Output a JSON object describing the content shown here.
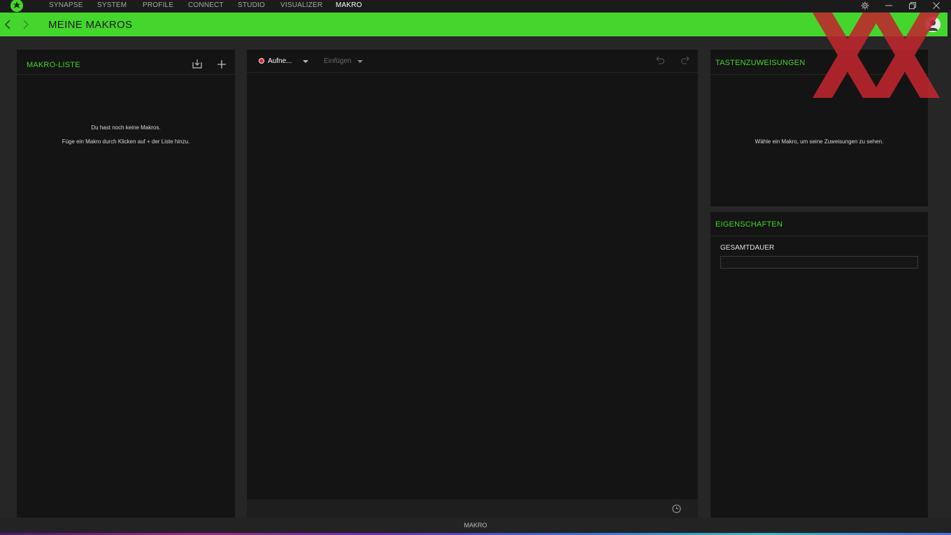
{
  "nav": {
    "items": [
      "SYNAPSE",
      "SYSTEM",
      "PROFILE",
      "CONNECT",
      "STUDIO",
      "VISUALIZER",
      "MAKRO"
    ],
    "active": "MAKRO"
  },
  "header": {
    "title": "MEINE MAKROS"
  },
  "macro_list": {
    "title": "MAKRO-LISTE",
    "empty_line1": "Du hast noch keine Makros.",
    "empty_line2": "Füge ein Makro durch Klicken auf + der Liste hinzu."
  },
  "editor": {
    "record_label": "Aufne...",
    "insert_label": "Einfügen"
  },
  "assignments": {
    "title": "TASTENZUWEISUNGEN",
    "empty_text": "Wähle ein Makro, um seine Zuweisungen zu sehen."
  },
  "properties": {
    "title": "EIGENSCHAFTEN",
    "total_duration_label": "GESAMTDAUER",
    "total_duration_value": ""
  },
  "statusbar": {
    "label": "MAKRO"
  },
  "colors": {
    "accent": "#44d62c",
    "panel_bg": "#141414",
    "app_bg": "#262626",
    "record_dot": "#e0242c"
  },
  "icons": [
    "razer-logo-icon",
    "settings-gear-icon",
    "minimize-icon",
    "restore-icon",
    "close-icon",
    "back-arrow-icon",
    "forward-arrow-icon",
    "user-avatar-icon",
    "import-icon",
    "add-icon",
    "record-icon",
    "chevron-down-icon",
    "undo-icon",
    "redo-icon",
    "clock-icon"
  ]
}
